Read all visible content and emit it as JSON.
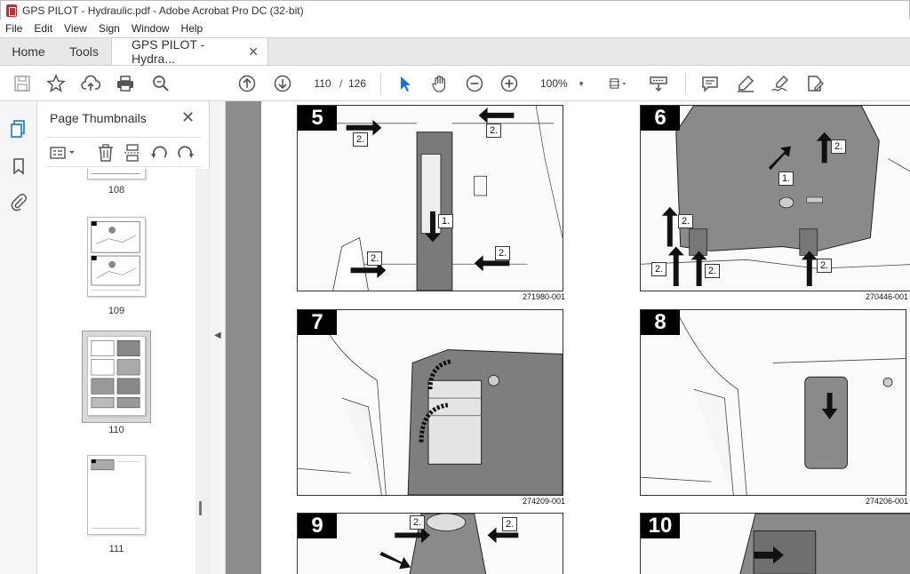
{
  "window": {
    "title": "GPS PILOT - Hydraulic.pdf - Adobe Acrobat Pro DC (32-bit)"
  },
  "menu": [
    "File",
    "Edit",
    "View",
    "Sign",
    "Window",
    "Help"
  ],
  "tabs": {
    "home": "Home",
    "tools": "Tools",
    "doc": "GPS PILOT - Hydra...",
    "doc_close": "✕"
  },
  "toolbar": {
    "page_current": "110",
    "page_sep": "/",
    "page_total": "126",
    "zoom": "100%"
  },
  "panel": {
    "title": "Page Thumbnails",
    "close": "✕",
    "thumbnails": [
      {
        "label": "108"
      },
      {
        "label": "109"
      },
      {
        "label": "110",
        "selected": true
      },
      {
        "label": "111"
      }
    ]
  },
  "page": {
    "figures": [
      {
        "num": "5",
        "code": "271980-001",
        "callouts": [
          "2.",
          "2.",
          "1.",
          "2.",
          "2."
        ]
      },
      {
        "num": "6",
        "code": "270446-001",
        "callouts": [
          "2.",
          "1.",
          "2.",
          "2.",
          "2.",
          "2."
        ]
      },
      {
        "num": "7",
        "code": "274209-001",
        "callouts": []
      },
      {
        "num": "8",
        "code": "274206-001",
        "callouts": []
      },
      {
        "num": "9",
        "code": "",
        "callouts": [
          "2.",
          "2."
        ]
      },
      {
        "num": "10",
        "code": "",
        "callouts": []
      }
    ]
  }
}
